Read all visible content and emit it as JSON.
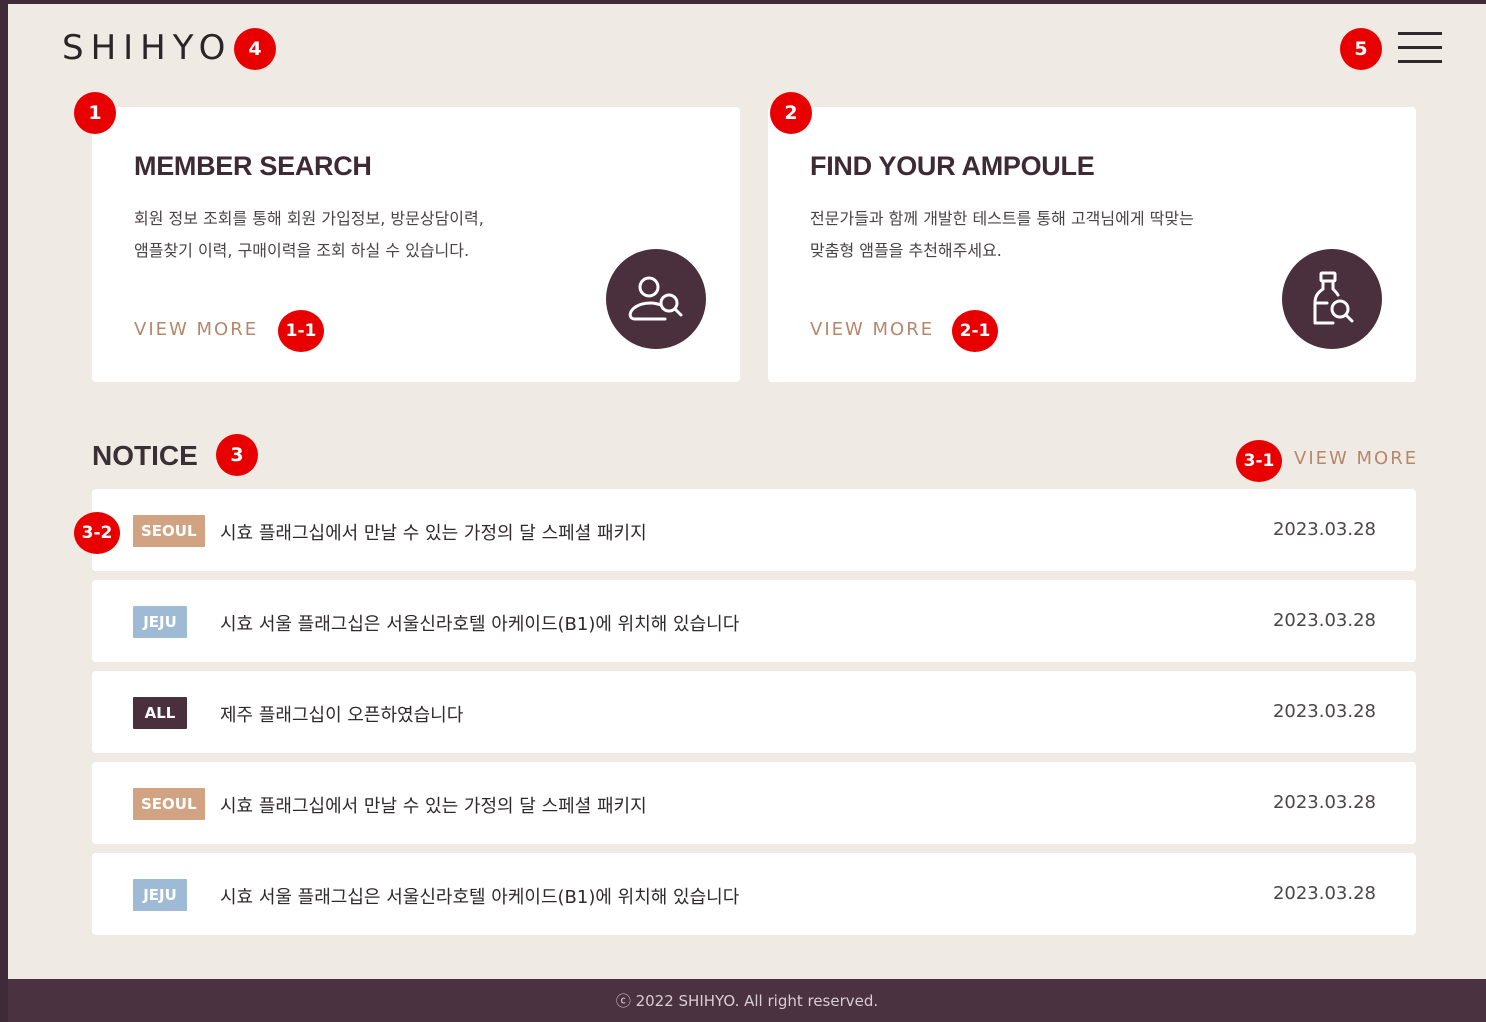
{
  "header": {
    "logo": "SHIHYO",
    "menu_icon": "hamburger-menu-icon"
  },
  "cards": [
    {
      "title": "MEMBER SEARCH",
      "desc_lines": [
        "회원 정보 조회를 통해 회원 가입정보, 방문상담이력,",
        "앰플찾기 이력, 구매이력을 조회 하실 수 있습니다."
      ],
      "link": "VIEW MORE",
      "icon": "member-search-icon"
    },
    {
      "title": "FIND YOUR AMPOULE",
      "desc_lines": [
        "전문가들과 함께 개발한 테스트를 통해 고객님에게 딱맞는",
        "맞춤형 앰플을 추천해주세요."
      ],
      "link": "VIEW MORE",
      "icon": "ampoule-search-icon"
    }
  ],
  "notice": {
    "title": "NOTICE",
    "more": "VIEW MORE",
    "items": [
      {
        "badge": "SEOUL",
        "text": "시효 플래그십에서 만날 수 있는 가정의 달 스페셜 패키지",
        "date": "2023.03.28"
      },
      {
        "badge": "JEJU",
        "text": "시효 서울 플래그십은 서울신라호텔 아케이드(B1)에 위치해 있습니다",
        "date": "2023.03.28"
      },
      {
        "badge": "ALL",
        "text": "제주 플래그십이 오픈하였습니다",
        "date": "2023.03.28"
      },
      {
        "badge": "SEOUL",
        "text": "시효 플래그십에서 만날 수 있는 가정의 달 스페셜 패키지",
        "date": "2023.03.28"
      },
      {
        "badge": "JEJU",
        "text": "시효 서울 플래그십은 서울신라호텔 아케이드(B1)에 위치해 있습니다",
        "date": "2023.03.28"
      }
    ]
  },
  "markers": {
    "m1": "1",
    "m1_1": "1-1",
    "m2": "2",
    "m2_1": "2-1",
    "m3": "3",
    "m3_1": "3-1",
    "m3_2": "3-2",
    "m4": "4",
    "m5": "5"
  },
  "footer": {
    "copyright": "ⓒ 2022 SHIHYO. All right reserved."
  },
  "colors": {
    "brand": "#4a2f3d",
    "accent": "#b7876c",
    "background": "#efebe4",
    "marker": "#e80000",
    "badge_seoul": "#d1a383",
    "badge_jeju": "#9ebad4",
    "badge_all": "#4a2f3d"
  }
}
